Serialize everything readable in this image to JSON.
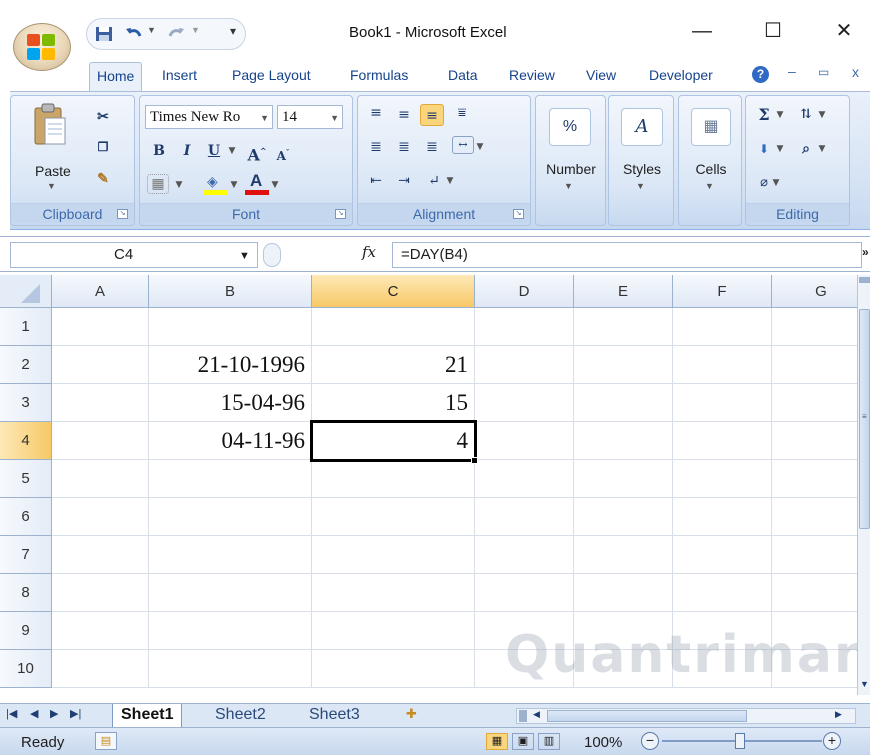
{
  "window": {
    "title": "Book1 - Microsoft Excel",
    "minimize": "—",
    "maximize": "☐",
    "close": "✕"
  },
  "tabs": [
    "Home",
    "Insert",
    "Page Layout",
    "Formulas",
    "Data",
    "Review",
    "View",
    "Developer"
  ],
  "ribbon": {
    "clipboard": {
      "label": "Clipboard",
      "paste": "Paste"
    },
    "font": {
      "label": "Font",
      "name": "Times New Ro",
      "size": "14"
    },
    "alignment": {
      "label": "Alignment"
    },
    "number": {
      "label": "Number",
      "percent": "%"
    },
    "styles": {
      "label": "Styles"
    },
    "cells": {
      "label": "Cells"
    },
    "editing": {
      "label": "Editing",
      "sum": "Σ"
    }
  },
  "formula_bar": {
    "name_box": "C4",
    "fx": "fx",
    "formula": "=DAY(B4)"
  },
  "grid": {
    "columns": [
      "A",
      "B",
      "C",
      "D",
      "E",
      "F",
      "G"
    ],
    "rows": [
      "1",
      "2",
      "3",
      "4",
      "5",
      "6",
      "7",
      "8",
      "9",
      "10"
    ],
    "active_cell": "C4",
    "cells": {
      "B2": "21-10-1996",
      "C2": "21",
      "B3": "15-04-96",
      "C3": "15",
      "B4": "04-11-96",
      "C4": "4"
    }
  },
  "sheets": [
    "Sheet1",
    "Sheet2",
    "Sheet3"
  ],
  "active_sheet": "Sheet1",
  "status": {
    "text": "Ready",
    "zoom": "100%"
  },
  "watermark": "Quantrimang",
  "colors": {
    "ribbon_blue": "#d7e4f5",
    "selection_header": "#f7c866",
    "tab_text": "#15428b"
  }
}
